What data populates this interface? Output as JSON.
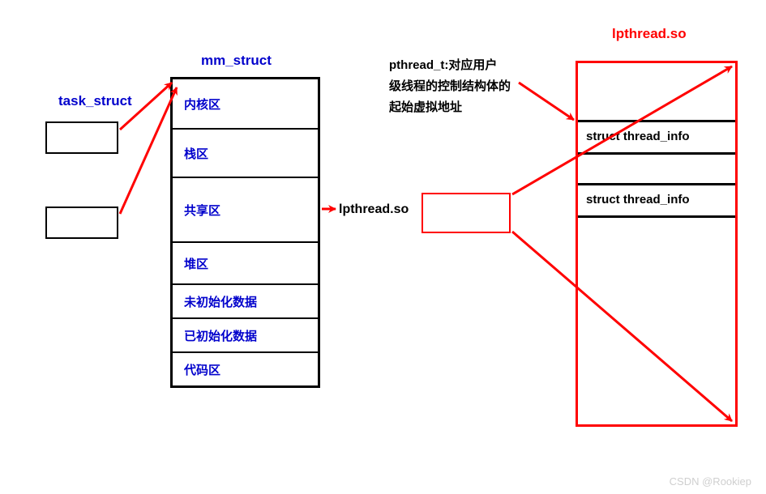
{
  "labels": {
    "task_struct": "task_struct",
    "mm_struct": "mm_struct",
    "lpthread_so_title": "lpthread.so",
    "lpthread_so_mid": "lpthread.so",
    "pthread_t_line1": "pthread_t:对应用户",
    "pthread_t_line2": "级线程的控制结构体的",
    "pthread_t_line3": "起始虚拟地址",
    "thread_info_1": "struct thread_info",
    "thread_info_2": "struct thread_info",
    "watermark": "CSDN @Rookiep"
  },
  "mm_regions": [
    "内核区",
    "栈区",
    "共享区",
    "堆区",
    "未初始化数据",
    "已初始化数据",
    "代码区"
  ],
  "colors": {
    "arrow_red": "#ff0000",
    "text_blue": "#0000cc",
    "border_black": "#000000"
  }
}
